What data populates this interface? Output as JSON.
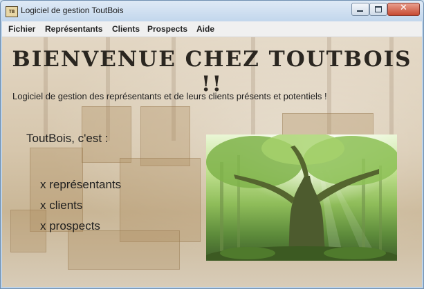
{
  "window": {
    "app_icon_text": "TB",
    "title": "Logiciel de gestion ToutBois"
  },
  "menu": [
    "Fichier",
    "Représentants",
    "Clients",
    "Prospects",
    "Aide"
  ],
  "content": {
    "headline": "BIENVENUE CHEZ TOUTBOIS !!",
    "subtitle": "Logiciel de gestion des représentants et de leurs clients présents et potentiels !",
    "intro": "ToutBois, c'est :",
    "list": [
      "x représentants",
      "x clients",
      "x prospects"
    ]
  }
}
